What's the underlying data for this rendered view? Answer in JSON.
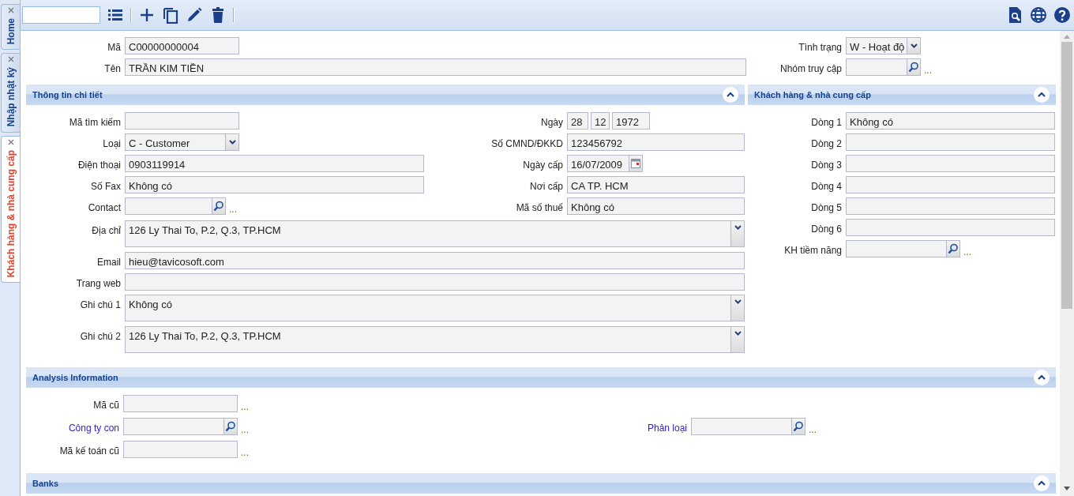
{
  "side_tabs": [
    {
      "label": "Home",
      "selected": false
    },
    {
      "label": "Nhập nhật ký",
      "selected": false
    },
    {
      "label": "Khách hàng & nhà cung cấp",
      "selected": true
    }
  ],
  "header": {
    "left": [
      {
        "label": "Mã",
        "kind": "text",
        "value": "C00000000004"
      },
      {
        "label": "Tên",
        "kind": "text",
        "value": "TRẦN KIM TIỀN"
      }
    ],
    "right": [
      {
        "label": "Tình trạng",
        "kind": "select",
        "value": "W - Hoạt độ"
      },
      {
        "label": "Nhóm truy cập",
        "kind": "lookup",
        "more": "..."
      }
    ]
  },
  "details": {
    "title": "Thông tin chi tiết",
    "expanded": true,
    "left": [
      {
        "label": "Mã tìm kiếm",
        "kind": "text"
      },
      {
        "label": "Loại",
        "kind": "select",
        "value": "C - Customer"
      },
      {
        "label": "Điện thoại",
        "kind": "text",
        "value": "0903119914"
      },
      {
        "label": "Số Fax",
        "kind": "text",
        "value": "Không có"
      },
      {
        "label": "Contact",
        "kind": "lookup",
        "more": "..."
      }
    ],
    "right": [
      {
        "label": "Ngày",
        "kind": "date3",
        "parts": [
          "28",
          "12",
          "1972"
        ]
      },
      {
        "label": "Số CMND/ĐKKD",
        "kind": "text",
        "value": "123456792"
      },
      {
        "label": "Ngày cấp",
        "kind": "date",
        "value": "16/07/2009"
      },
      {
        "label": "Nơi cấp",
        "kind": "text",
        "value": "CA TP. HCM"
      },
      {
        "label": "Mã số thuế",
        "kind": "text",
        "value": "Không có"
      }
    ],
    "full": [
      {
        "label": "Địa chỉ",
        "kind": "textarea",
        "value": "126 Ly Thai To, P.2, Q.3, TP.HCM"
      },
      {
        "label": "Email",
        "kind": "text",
        "value": "hieu@tavicosoft.com"
      },
      {
        "label": "Trang web",
        "kind": "text"
      },
      {
        "label": "Ghi chú 1",
        "kind": "textarea",
        "value": "Không có"
      },
      {
        "label": "Ghi chú 2",
        "kind": "textarea",
        "value": "126 Ly Thai To, P.2, Q.3, TP.HCM"
      }
    ]
  },
  "customer_supplier": {
    "title": "Khách hàng & nhà cung cấp",
    "expanded": true,
    "fields": [
      {
        "label": "Dòng 1",
        "kind": "text",
        "value": "Không có"
      },
      {
        "label": "Dòng 2",
        "kind": "text"
      },
      {
        "label": "Dòng 3",
        "kind": "text"
      },
      {
        "label": "Dòng 4",
        "kind": "text"
      },
      {
        "label": "Dòng 5",
        "kind": "text"
      },
      {
        "label": "Dòng 6",
        "kind": "text"
      },
      {
        "label": "KH tiềm năng",
        "kind": "lookup",
        "more": "..."
      }
    ]
  },
  "analysis": {
    "title": "Analysis Information",
    "expanded": true,
    "left": [
      {
        "label": "Mã cũ",
        "kind": "text",
        "more": "...",
        "link": false
      },
      {
        "label": "Công ty con",
        "kind": "lookup",
        "more": "...",
        "link": true
      },
      {
        "label": "Mã kế toán cũ",
        "kind": "text",
        "more": "...",
        "link": false
      }
    ],
    "right": [
      {
        "label": "Phân loại",
        "kind": "lookup",
        "more": "...",
        "link": true
      }
    ]
  },
  "banks": {
    "title": "Banks",
    "expanded": true
  }
}
